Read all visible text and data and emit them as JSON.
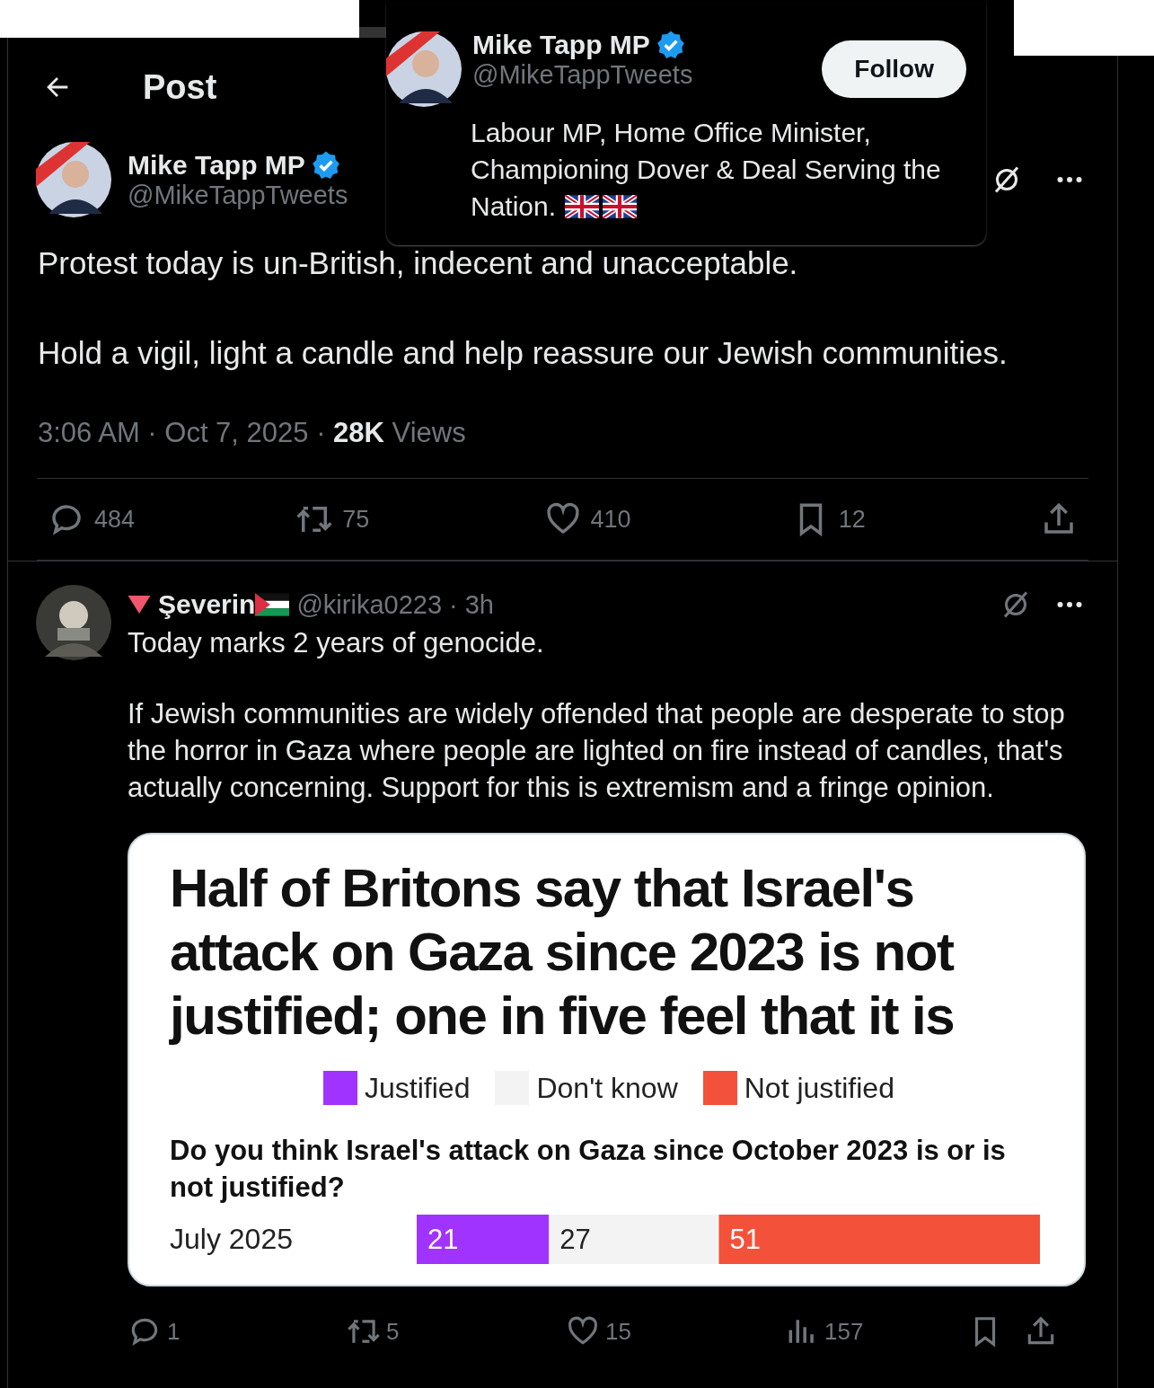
{
  "header": {
    "title": "Post"
  },
  "hover_card": {
    "name": "Mike Tapp MP",
    "verified": true,
    "handle": "@MikeTappTweets",
    "follow_button": "Follow",
    "bio_lines": [
      "Labour MP, Home Office Minister,",
      "Championing Dover & Deal Serving the",
      "Nation."
    ]
  },
  "post": {
    "author": {
      "name": "Mike Tapp MP",
      "verified": true,
      "handle": "@MikeTappTweets"
    },
    "paragraphs": [
      "Protest today is un-British, indecent and unacceptable.",
      "Hold a vigil, light a candle and help reassure our Jewish communities."
    ],
    "meta": "3:06 AM · Oct 7, 2025 · **28K** Views",
    "actions": [
      {
        "kind": "reply",
        "count": "484"
      },
      {
        "kind": "repost",
        "count": "75"
      },
      {
        "kind": "like",
        "count": "410"
      },
      {
        "kind": "bookmark",
        "count": "12"
      },
      {
        "kind": "share"
      }
    ]
  },
  "reply": {
    "author": {
      "name": "Şeverin",
      "handle": "@kirika0223",
      "time": "· 3h"
    },
    "paragraphs": [
      "Today marks 2 years of genocide.",
      "If Jewish communities are widely offended that people are desperate to stop the horror in Gaza where people are lighted on fire instead of candles, that's actually concerning. Support for this is extremism and a fringe opinion."
    ],
    "card": {
      "title": "Half of Britons say that Israel's attack on Gaza since 2023 is not justified; one in five feel that it is",
      "question": "Do you think Israel's attack on Gaza since October 2023 is or is not justified?",
      "chart_data": {
        "type": "bar",
        "orientation": "horizontal",
        "stacked": true,
        "data_labels": true,
        "categories": [
          "July 2025"
        ],
        "series": [
          {
            "name": "Justified",
            "color": "#a033ff",
            "values": [
              21
            ]
          },
          {
            "name": "Don't know",
            "color": "#f3f3f3",
            "values": [
              27
            ]
          },
          {
            "name": "Not justified",
            "color": "#f4513a",
            "values": [
              51
            ]
          }
        ]
      }
    },
    "actions": [
      {
        "kind": "reply",
        "count": "1"
      },
      {
        "kind": "repost",
        "count": "5"
      },
      {
        "kind": "like",
        "count": "15"
      },
      {
        "kind": "views",
        "count": "157"
      },
      {
        "kind": "bookmark"
      },
      {
        "kind": "share"
      }
    ]
  }
}
